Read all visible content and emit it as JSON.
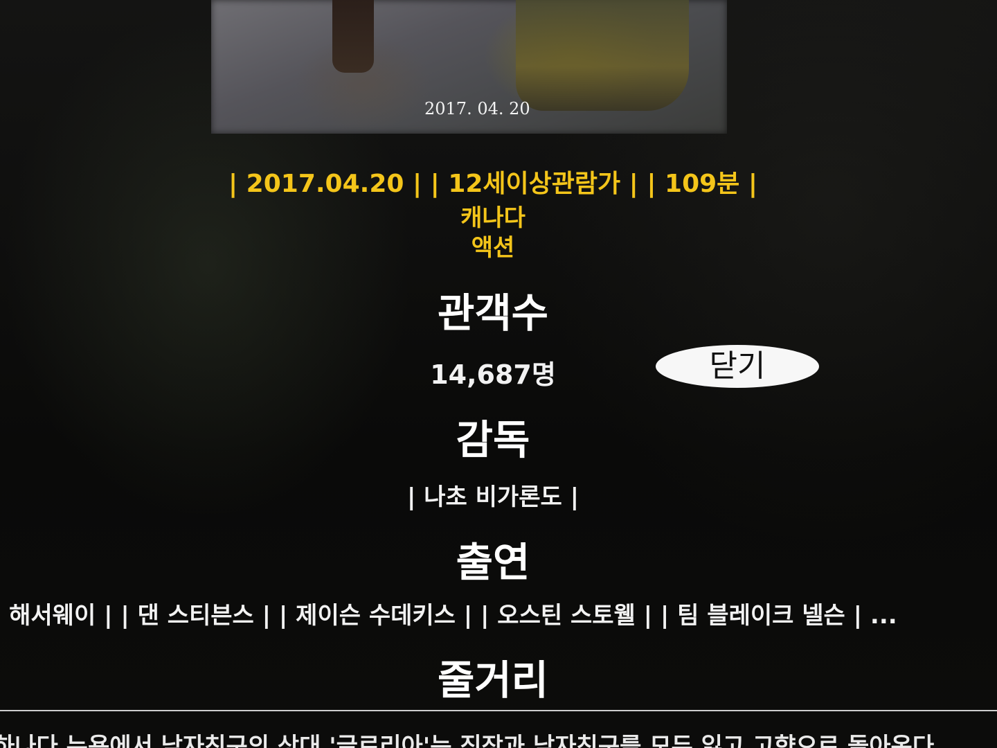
{
  "poster": {
    "date_text": "2017. 04. 20"
  },
  "meta": {
    "line1": "| 2017.04.20 | | 12세이상관람가 | | 109분 |",
    "country": "캐나다",
    "genre": "액션"
  },
  "audience": {
    "title": "관객수",
    "value": "14,687명"
  },
  "director": {
    "title": "감독",
    "value": "| 나초 비가론도 |"
  },
  "cast": {
    "title": "출연",
    "value": "앤 해서웨이 | | 댄 스티븐스 | | 제이슨 수데키스 | | 오스틴 스토웰 | | 팀 블레이크 넬슨 | ..."
  },
  "synopsis": {
    "title": "줄거리",
    "text_partial": "하나다 뉴욕에서 남자친구의 상대 '글로리아'는 직장과 남자친구를 모두 잃고 고향으로 돌아온다"
  },
  "close_button": {
    "label": "닫기"
  }
}
